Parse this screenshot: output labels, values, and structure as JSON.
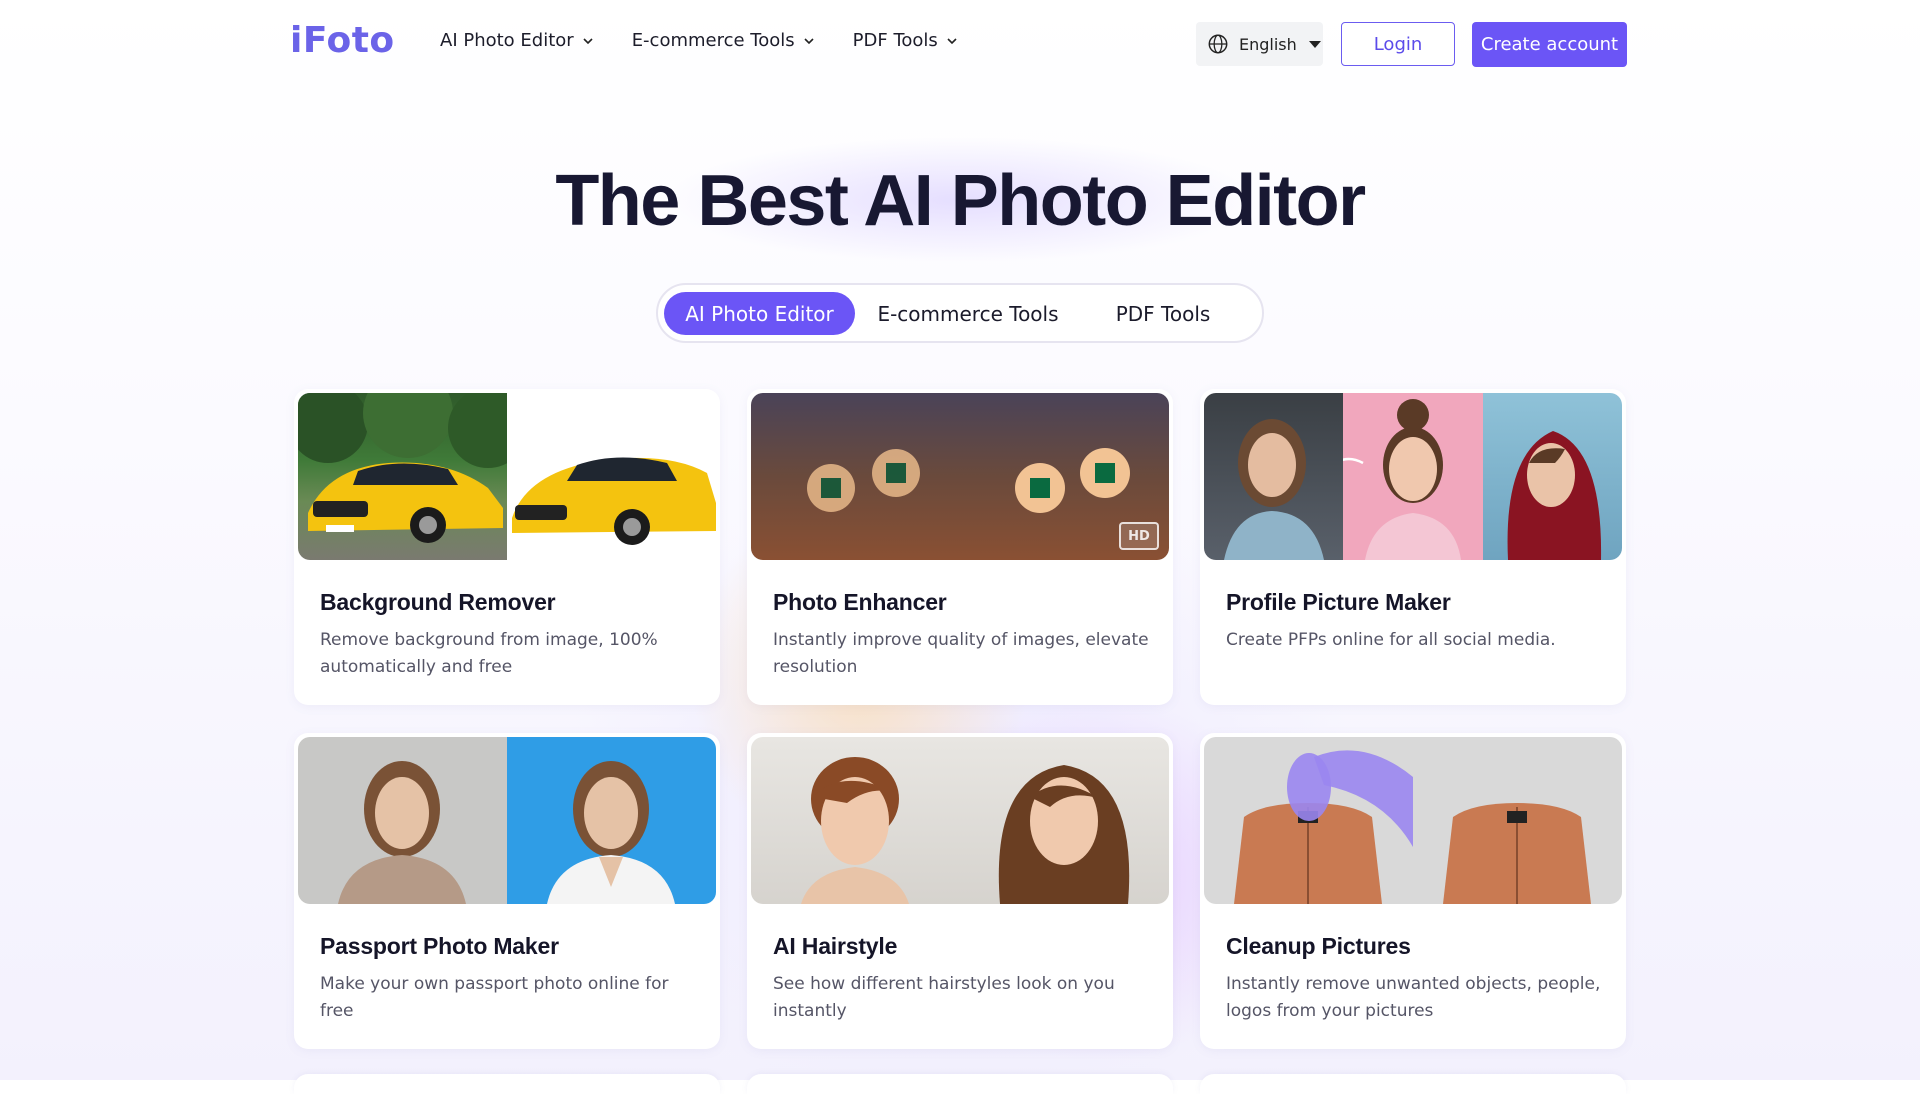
{
  "header": {
    "logo_text": "iFoto",
    "nav": [
      {
        "label": "AI Photo Editor"
      },
      {
        "label": "E-commerce Tools"
      },
      {
        "label": "PDF Tools"
      }
    ],
    "language": "English",
    "login_label": "Login",
    "create_account_label": "Create account"
  },
  "hero": {
    "title": "The Best AI Photo Editor"
  },
  "tabs": [
    {
      "label": "AI Photo Editor",
      "active": true
    },
    {
      "label": "E-commerce Tools",
      "active": false
    },
    {
      "label": "PDF Tools",
      "active": false
    }
  ],
  "cards": [
    {
      "title": "Background Remover",
      "description": "Remove background from image, 100% automatically and free"
    },
    {
      "title": "Photo Enhancer",
      "description": "Instantly improve quality of images, elevate resolution",
      "badge": "HD"
    },
    {
      "title": "Profile Picture Maker",
      "description": "Create PFPs online for all social media."
    },
    {
      "title": "Passport Photo Maker",
      "description": "Make your own passport photo online for free"
    },
    {
      "title": "AI Hairstyle",
      "description": "See how different hairstyles look on you instantly"
    },
    {
      "title": "Cleanup Pictures",
      "description": "Instantly remove unwanted objects, people, logos from your pictures"
    }
  ],
  "colors": {
    "accent": "#6b55f6",
    "logo": "#6b63e8",
    "title": "#181832"
  },
  "icons": {
    "nav_chevron": "chevron-down-icon",
    "language": "globe-icon",
    "language_caret": "caret-down-icon"
  }
}
